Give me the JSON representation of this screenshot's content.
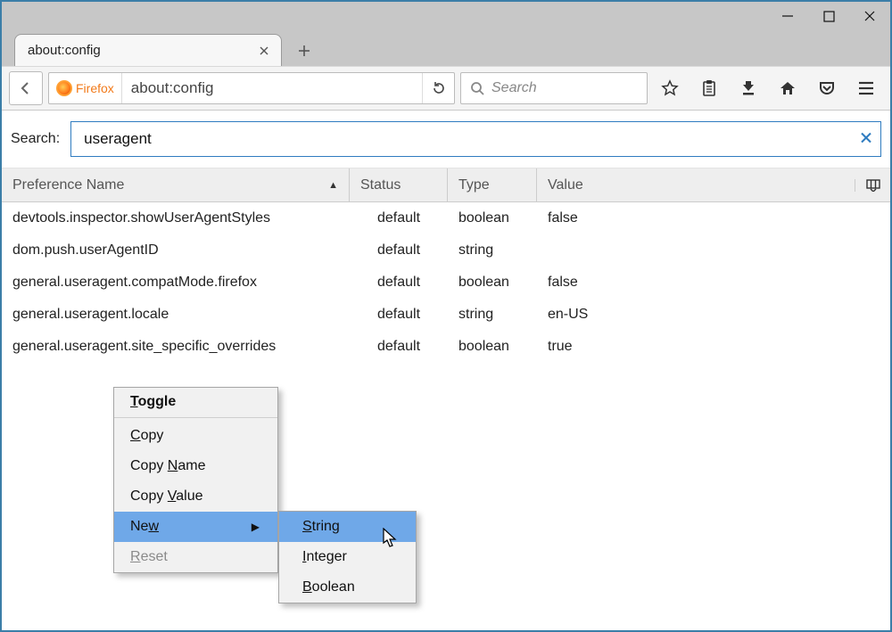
{
  "tab": {
    "title": "about:config"
  },
  "url": {
    "identity_label": "Firefox",
    "text": "about:config"
  },
  "searchbox": {
    "placeholder": "Search"
  },
  "config": {
    "search_label": "Search:",
    "search_value": "useragent",
    "columns": {
      "name": "Preference Name",
      "status": "Status",
      "type": "Type",
      "value": "Value"
    },
    "rows": [
      {
        "name": "devtools.inspector.showUserAgentStyles",
        "status": "default",
        "type": "boolean",
        "value": "false"
      },
      {
        "name": "dom.push.userAgentID",
        "status": "default",
        "type": "string",
        "value": ""
      },
      {
        "name": "general.useragent.compatMode.firefox",
        "status": "default",
        "type": "boolean",
        "value": "false"
      },
      {
        "name": "general.useragent.locale",
        "status": "default",
        "type": "string",
        "value": "en-US"
      },
      {
        "name": "general.useragent.site_specific_overrides",
        "status": "default",
        "type": "boolean",
        "value": "true"
      }
    ]
  },
  "ctx": {
    "toggle": "Toggle",
    "toggle_u": "T",
    "copy": "Copy",
    "copy_u": "C",
    "copy_name": "Copy Name",
    "copy_name_u": "N",
    "copy_value": "Copy Value",
    "copy_value_u": "V",
    "new": "New",
    "new_u": "w",
    "reset": "Reset",
    "reset_u": "R"
  },
  "submenu": {
    "string": "String",
    "string_u": "S",
    "integer": "Integer",
    "integer_u": "I",
    "boolean": "Boolean",
    "boolean_u": "B"
  }
}
